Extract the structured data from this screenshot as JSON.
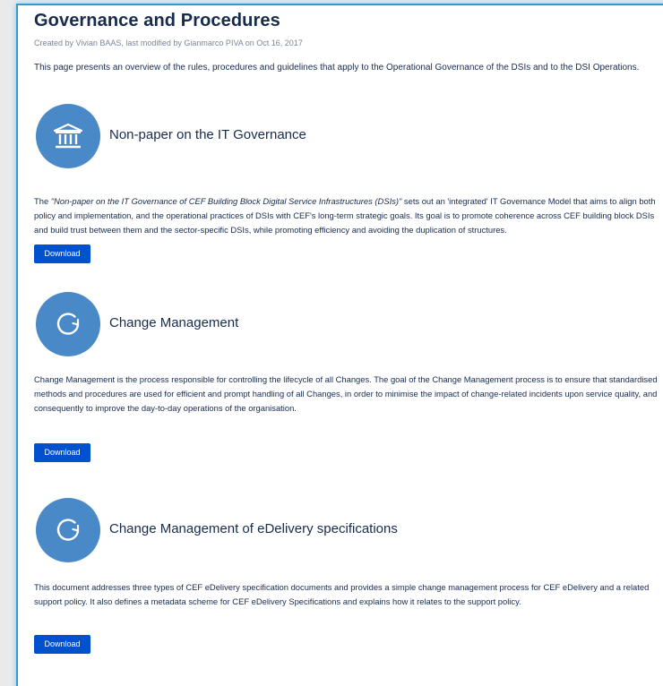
{
  "page": {
    "title": "Governance and Procedures",
    "byline": "Created by Vivian BAAS, last modified by Gianmarco PIVA on Oct 16, 2017",
    "intro": "This page presents an overview of the rules, procedures and guidelines that apply to the Operational Governance of the DSIs and to the DSI Operations."
  },
  "sections": [
    {
      "icon": "institution-icon",
      "title": "Non-paper on the IT Governance",
      "body_prefix": "The ",
      "body_italic": "\"Non-paper on the IT Governance of CEF Building Block Digital Service Infrastructures (DSIs)\"",
      "body_rest": " sets out an 'integrated' IT Governance Model that aims to align both policy and implementation, and the operational practices of DSIs with CEF's long-term strategic goals. Its goal is to promote coherence across CEF building block DSIs and build trust between them and the sector-specific DSIs, while promoting efficiency and avoiding the duplication of structures.",
      "button": "Download"
    },
    {
      "icon": "refresh-icon",
      "title": "Change Management",
      "body": "Change Management is the process responsible for controlling the lifecycle of all Changes. The goal of the Change Management process is to ensure that standardised methods and procedures are used for efficient and prompt handling of all Changes, in order to minimise the impact of change-related incidents upon service quality, and consequently to improve the day-to-day operations of the organisation.",
      "button": "Download"
    },
    {
      "icon": "refresh-icon",
      "title": "Change Management of eDelivery specifications",
      "body": "This document addresses three types of CEF eDelivery specification documents and provides a simple change management process for CEF eDelivery and a related support policy. It also defines a metadata scheme for CEF eDelivery Specifications and explains how it relates to the support policy.",
      "button": "Download"
    }
  ],
  "colors": {
    "accent": "#0052cc",
    "icon_circle": "#4a89c8",
    "frame_border": "#2e9bd6"
  }
}
